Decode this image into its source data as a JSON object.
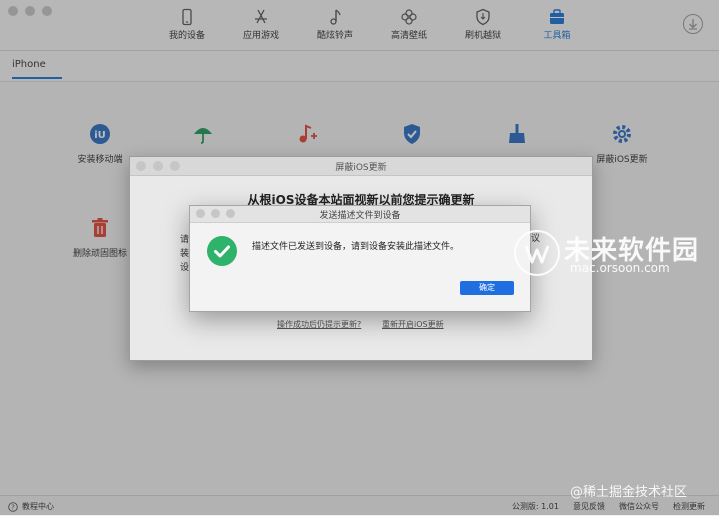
{
  "nav": {
    "items": [
      {
        "label": "我的设备",
        "icon": "phone-icon"
      },
      {
        "label": "应用游戏",
        "icon": "app-store-icon"
      },
      {
        "label": "酷炫铃声",
        "icon": "music-note-icon"
      },
      {
        "label": "高清壁纸",
        "icon": "flower-icon"
      },
      {
        "label": "刷机越狱",
        "icon": "shield-icon"
      },
      {
        "label": "工具箱",
        "icon": "toolbox-icon"
      }
    ],
    "active_index": 5
  },
  "tabs": {
    "device": "iPhone"
  },
  "tools": [
    {
      "label": "安装移动端",
      "icon": "iu-app-icon"
    },
    {
      "label": "",
      "icon": "umbrella-icon"
    },
    {
      "label": "",
      "icon": "ringtone-plus-icon"
    },
    {
      "label": "",
      "icon": "check-shield-icon"
    },
    {
      "label": "",
      "icon": "broom-icon"
    },
    {
      "label": "屏蔽iOS更新",
      "icon": "gear-icon"
    },
    {
      "label": "删除顽固图标",
      "icon": "trash-icon"
    }
  ],
  "block_window": {
    "title": "屏蔽iOS更新",
    "headline": "从根iOS设备本站面视新以前您提示确更新",
    "body_lines": [
      "请",
      "装",
      "设"
    ],
    "fragment": "议",
    "link_left": "操作成功后仍提示更新?",
    "link_right": "重新开启iOS更新"
  },
  "dialog": {
    "title": "发送描述文件到设备",
    "message": "描述文件已发送到设备，请到设备安装此描述文件。",
    "ok_label": "确定"
  },
  "status": {
    "help": "教程中心",
    "version": "公测版: 1.01",
    "feedback": "意见反馈",
    "wechat": "微信公众号",
    "check_update": "检测更新"
  },
  "watermark": {
    "title": "未来软件园",
    "subtitle": "mac.orsoon.com",
    "bottom": "@稀土掘金技术社区"
  },
  "colors": {
    "accent": "#1a74d8",
    "success": "#2fb36a",
    "ok_button": "#1f6fe0",
    "tool_icon": "#2b6cc4",
    "tool_green": "#1f9a5a",
    "tool_red": "#e0463a"
  }
}
